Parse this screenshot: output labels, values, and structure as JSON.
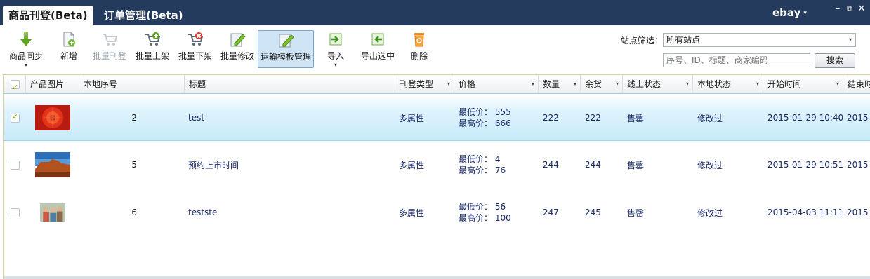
{
  "tabs": [
    {
      "label": "商品刊登(Beta)",
      "active": true
    },
    {
      "label": "订单管理(Beta)",
      "active": false
    }
  ],
  "brand": {
    "label": "ebay",
    "caret": "▾"
  },
  "window_controls": [
    {
      "name": "minimize",
      "glyph": "–"
    },
    {
      "name": "restore",
      "glyph": "⧉"
    },
    {
      "name": "close",
      "glyph": "✕"
    }
  ],
  "toolbar": {
    "buttons": [
      {
        "key": "sync",
        "label": "商品同步",
        "icon": "download-arrow-icon",
        "has_menu": true,
        "enabled": true
      },
      {
        "key": "add",
        "label": "新增",
        "icon": "new-document-icon",
        "enabled": true
      },
      {
        "key": "batch_list",
        "label": "批量刊登",
        "icon": "cart-publish-icon",
        "enabled": false
      },
      {
        "key": "batch_up",
        "label": "批量上架",
        "icon": "cart-add-icon",
        "enabled": true
      },
      {
        "key": "batch_down",
        "label": "批量下架",
        "icon": "cart-remove-icon",
        "enabled": true
      },
      {
        "key": "batch_edit",
        "label": "批量修改",
        "icon": "edit-pencil-icon",
        "enabled": true
      },
      {
        "key": "shipping_tpl",
        "label": "运输模板管理",
        "icon": "template-pencil-icon",
        "enabled": true,
        "selected": true
      },
      {
        "key": "import",
        "label": "导入",
        "icon": "import-icon",
        "has_menu": true,
        "enabled": true
      },
      {
        "key": "export",
        "label": "导出选中",
        "icon": "export-icon",
        "enabled": true
      },
      {
        "key": "delete",
        "label": "删除",
        "icon": "recycle-bin-icon",
        "enabled": true
      }
    ],
    "menu_caret": "▾"
  },
  "filter": {
    "label": "站点筛选：",
    "selected": "所有站点",
    "search_placeholder": "序号、ID、标题、商家编码",
    "search_button": "搜索"
  },
  "grid": {
    "columns": [
      {
        "key": "check",
        "label": ""
      },
      {
        "key": "image",
        "label": "产品图片"
      },
      {
        "key": "seq",
        "label": "本地序号"
      },
      {
        "key": "title",
        "label": "标题"
      },
      {
        "key": "type",
        "label": "刊登类型",
        "sortable": true
      },
      {
        "key": "price",
        "label": "价格",
        "sortable": true
      },
      {
        "key": "qty",
        "label": "数量",
        "sortable": true
      },
      {
        "key": "stock",
        "label": "余货",
        "sortable": true
      },
      {
        "key": "online",
        "label": "线上状态",
        "sortable": true
      },
      {
        "key": "local",
        "label": "本地状态",
        "sortable": true
      },
      {
        "key": "start",
        "label": "开始时间",
        "sortable": true
      },
      {
        "key": "end",
        "label": "结束时"
      }
    ],
    "sort_glyph": "▾",
    "header_checked": true,
    "rows": [
      {
        "checked": true,
        "selected": true,
        "image": "red-flower-photo",
        "seq": "2",
        "title": "test",
        "type": "多属性",
        "price_min": "最低价： 555",
        "price_max": "最高价： 666",
        "qty": "222",
        "stock": "222",
        "online": "售罄",
        "local": "修改过",
        "start": "2015-01-29 10:40",
        "end": "2015"
      },
      {
        "checked": false,
        "selected": false,
        "image": "desert-rock-photo",
        "seq": "5",
        "title": "预约上市时间",
        "type": "多属性",
        "price_min": "最低价： 4",
        "price_max": "最高价： 76",
        "qty": "244",
        "stock": "244",
        "online": "售罄",
        "local": "修改过",
        "start": "2015-01-29 10:51",
        "end": "2015"
      },
      {
        "checked": false,
        "selected": false,
        "image": "family-photo",
        "seq": "6",
        "title": "testste",
        "type": "多属性",
        "price_min": "最低价： 56",
        "price_max": "最高价： 100",
        "qty": "247",
        "stock": "245",
        "online": "售罄",
        "local": "修改过",
        "start": "2015-04-03 11:11",
        "end": "2015"
      }
    ]
  },
  "colors": {
    "titlebar": "#243b5e",
    "selected_row": "#c8ebfa",
    "cell_text": "#1a2b6b",
    "grid_border": "#e4cf9b"
  }
}
